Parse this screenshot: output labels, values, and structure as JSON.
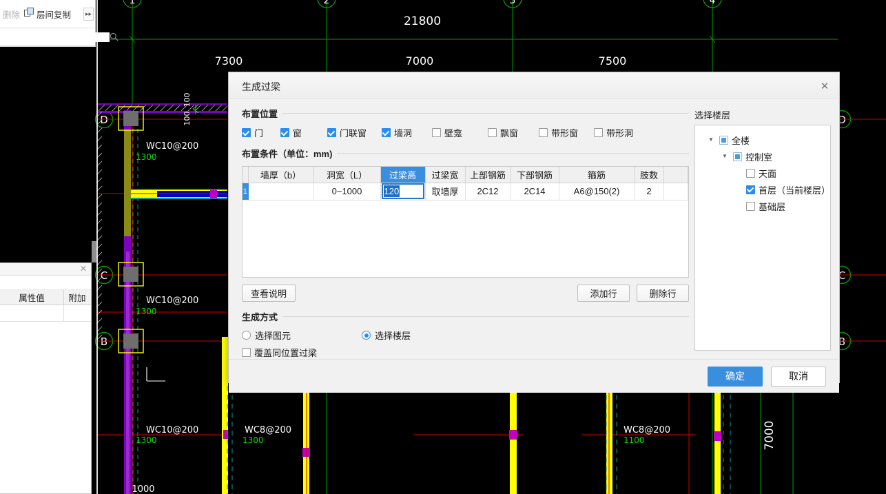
{
  "left_panel": {
    "toolbar": {
      "delete_label": "删除",
      "copy_between_floors_label": "层间复制",
      "overflow_label": "▸▸"
    },
    "search": {
      "value": "",
      "placeholder": ""
    },
    "properties": {
      "columns": [
        "属性值",
        "附加"
      ],
      "rows": [
        {
          "value": "",
          "extra": ""
        }
      ]
    }
  },
  "cad": {
    "top_total_dimension": "21800",
    "top_segments": [
      "7300",
      "7000",
      "7500"
    ],
    "right_dimension": "7000",
    "bottom_dimension": "1000",
    "vertical_axis_labels": [
      "D",
      "C",
      "B"
    ],
    "top_axis_labels": [
      "1",
      "2",
      "3",
      "4"
    ],
    "right_axis_labels": [
      "D",
      "C",
      "B"
    ],
    "wall_labels": [
      "WC10@200",
      "WC10@200",
      "WC10@200",
      "WC8@200",
      "WC8@200"
    ],
    "wall_dim_labels": [
      "1300",
      "1300",
      "1300",
      "1300",
      "1100",
      "1300"
    ],
    "small_dim_labels": [
      "100",
      "100"
    ],
    "colors": {
      "background": "#000000",
      "axis_green": "#00a000",
      "grid_red": "#d60000",
      "wall_yellow": "#ffff00",
      "wall_purple": "#8000c0",
      "wall_olive": "#8a8a16",
      "wall_blue": "#0000c8",
      "dim_text": "#ffffff",
      "dim_green_text": "#00e000",
      "dashed_cyan": "#00a0a0"
    }
  },
  "dialog": {
    "title": "生成过梁",
    "close_icon": "✕",
    "placement_section": {
      "title": "布置位置",
      "options": [
        {
          "label": "门",
          "checked": true
        },
        {
          "label": "窗",
          "checked": true
        },
        {
          "label": "门联窗",
          "checked": true
        },
        {
          "label": "墙洞",
          "checked": true
        },
        {
          "label": "壁龛",
          "checked": false
        },
        {
          "label": "飘窗",
          "checked": false
        },
        {
          "label": "带形窗",
          "checked": false
        },
        {
          "label": "带形洞",
          "checked": false
        }
      ]
    },
    "condition_section": {
      "title": "布置条件（单位：mm)",
      "columns": [
        "墙厚（b）",
        "洞宽（L）",
        "过梁高",
        "过梁宽",
        "上部钢筋",
        "下部钢筋",
        "箍筋",
        "肢数"
      ],
      "selected_column_index": 2,
      "rows": [
        {
          "index": "1",
          "wall_thickness": "",
          "opening_width": "0~1000",
          "lintel_height": "120",
          "lintel_width": "取墙厚",
          "top_rebar": "2C12",
          "bottom_rebar": "2C14",
          "stirrup": "A6@150(2)",
          "legs": "2"
        }
      ],
      "editing_cell_value": "120"
    },
    "table_buttons": {
      "view_help_label": "查看说明",
      "add_row_label": "添加行",
      "delete_row_label": "删除行"
    },
    "generate_section": {
      "title": "生成方式",
      "radios": [
        {
          "label": "选择图元",
          "selected": false
        },
        {
          "label": "选择楼层",
          "selected": true
        }
      ],
      "checkbox": {
        "label": "覆盖同位置过梁",
        "checked": false
      }
    },
    "floor_section": {
      "title": "选择楼层",
      "tree": [
        {
          "label": "全楼",
          "state": "partial",
          "expanded": true,
          "depth": 0
        },
        {
          "label": "控制室",
          "state": "partial",
          "expanded": true,
          "depth": 1
        },
        {
          "label": "天面",
          "state": "unchecked",
          "expanded": null,
          "depth": 2
        },
        {
          "label": "首层（当前楼层）",
          "state": "checked",
          "expanded": null,
          "depth": 2
        },
        {
          "label": "基础层",
          "state": "unchecked",
          "expanded": null,
          "depth": 2
        }
      ]
    },
    "footer": {
      "confirm_label": "确定",
      "cancel_label": "取消"
    },
    "accent_color": "#3a8ede"
  }
}
